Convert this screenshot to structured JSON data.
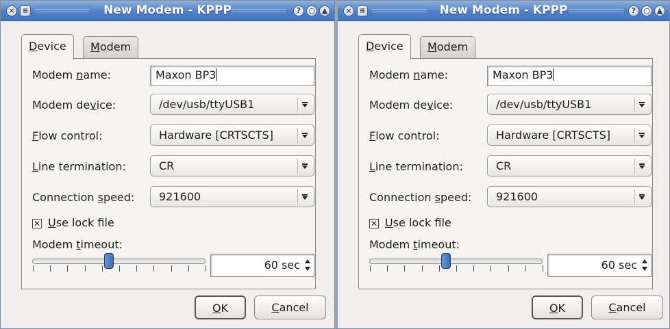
{
  "windows": [
    {
      "title": "New Modem - KPPP",
      "titlebar_buttons": [
        "close-icon",
        "menu-icon",
        "help-icon",
        "minimize-icon",
        "shade-icon"
      ],
      "tabs": [
        {
          "pre": "",
          "acc": "D",
          "post": "evice",
          "active": true
        },
        {
          "pre": "",
          "acc": "M",
          "post": "odem",
          "active": false
        }
      ],
      "modem_name": {
        "label_pre": "Modem ",
        "label_acc": "n",
        "label_post": "ame:",
        "value": "Maxon BP3"
      },
      "modem_device": {
        "label_pre": "Modem de",
        "label_acc": "v",
        "label_post": "ice:",
        "value": "/dev/usb/ttyUSB1"
      },
      "flow_control": {
        "label_pre": "",
        "label_acc": "F",
        "label_post": "low control:",
        "value": "Hardware [CRTSCTS]"
      },
      "line_termination": {
        "label_pre": "",
        "label_acc": "L",
        "label_post": "ine termination:",
        "value": "CR"
      },
      "connection_speed": {
        "label_pre": "Connection ",
        "label_acc": "s",
        "label_post": "peed:",
        "value": "921600"
      },
      "lock_file": {
        "label_pre": "",
        "label_acc": "U",
        "label_post": "se lock file",
        "checked": true
      },
      "timeout": {
        "label_pre": "Modem ",
        "label_acc": "t",
        "label_post": "imeout:",
        "value": "60 sec",
        "slider_fraction": 0.44
      },
      "buttons": {
        "ok": {
          "pre": "",
          "acc": "O",
          "post": "K"
        },
        "cancel": {
          "pre": "",
          "acc": "C",
          "post": "ancel"
        }
      }
    },
    {
      "title": "New Modem - KPPP",
      "titlebar_buttons": [
        "close-icon",
        "menu-icon",
        "help-icon",
        "minimize-icon",
        "shade-icon"
      ],
      "tabs": [
        {
          "pre": "",
          "acc": "D",
          "post": "evice",
          "active": true
        },
        {
          "pre": "",
          "acc": "M",
          "post": "odem",
          "active": false
        }
      ],
      "modem_name": {
        "label_pre": "Modem ",
        "label_acc": "n",
        "label_post": "ame:",
        "value": "Maxon BP3"
      },
      "modem_device": {
        "label_pre": "Modem de",
        "label_acc": "v",
        "label_post": "ice:",
        "value": "/dev/usb/ttyUSB1"
      },
      "flow_control": {
        "label_pre": "",
        "label_acc": "F",
        "label_post": "low control:",
        "value": "Hardware [CRTSCTS]"
      },
      "line_termination": {
        "label_pre": "",
        "label_acc": "L",
        "label_post": "ine termination:",
        "value": "CR"
      },
      "connection_speed": {
        "label_pre": "Connection ",
        "label_acc": "s",
        "label_post": "peed:",
        "value": "921600"
      },
      "lock_file": {
        "label_pre": "",
        "label_acc": "U",
        "label_post": "se lock file",
        "checked": true
      },
      "timeout": {
        "label_pre": "Modem ",
        "label_acc": "t",
        "label_post": "imeout:",
        "value": "60 sec",
        "slider_fraction": 0.44
      },
      "buttons": {
        "ok": {
          "pre": "",
          "acc": "O",
          "post": "K"
        },
        "cancel": {
          "pre": "",
          "acc": "C",
          "post": "ancel"
        }
      }
    }
  ]
}
